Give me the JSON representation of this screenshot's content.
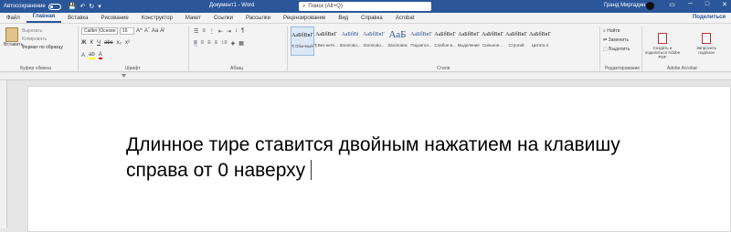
{
  "titlebar": {
    "autosave_label": "Автосохранение",
    "autosave_state": "off",
    "doc_title": "Документ1 - Word",
    "search_placeholder": "Поиск (Alt+Q)",
    "user_name": "Гранд Миргадин",
    "accent": "#2b579a"
  },
  "tabs": [
    "Файл",
    "Главная",
    "Вставка",
    "Рисование",
    "Конструктор",
    "Макет",
    "Ссылки",
    "Рассылки",
    "Рецензирование",
    "Вид",
    "Справка",
    "Acrobat"
  ],
  "active_tab": "Главная",
  "share_label": "Поделиться",
  "ribbon": {
    "clipboard": {
      "paste": "Вставить",
      "cut": "Вырезать",
      "copy": "Копировать",
      "format_painter": "Формат по образцу",
      "group": "Буфер обмена"
    },
    "font": {
      "name": "Calibri (Основн",
      "size": "16",
      "group": "Шрифт"
    },
    "paragraph": {
      "group": "Абзац"
    },
    "styles": {
      "group": "Стили",
      "items": [
        {
          "sample": "АаБбВвГ",
          "name": "¶ Обычный"
        },
        {
          "sample": "АаБбВвГ",
          "name": "¶ Без инте..."
        },
        {
          "sample": "АаБбВі",
          "name": "Заголово..."
        },
        {
          "sample": "АаБбВвГ",
          "name": "Заголово..."
        },
        {
          "sample": "АаБ",
          "name": "Заголовок"
        },
        {
          "sample": "АаБбВвГ",
          "name": "Подзагол..."
        },
        {
          "sample": "АаБбВеГ",
          "name": "Слабое в..."
        },
        {
          "sample": "АаБбВеГ",
          "name": "Выделение"
        },
        {
          "sample": "АаБбВвГ",
          "name": "Сильное..."
        },
        {
          "sample": "АаБбВвГ",
          "name": "Строгий"
        },
        {
          "sample": "АаБбВвГ",
          "name": "Цитата 2"
        }
      ]
    },
    "editing": {
      "find": "Найти",
      "replace": "Заменить",
      "select": "Выделить",
      "group": "Редактирование"
    },
    "adobe": {
      "create_share": "Создать и поделиться Adobe PDF",
      "request_sign": "Запросить подписи",
      "group": "Adobe Acrobat"
    }
  },
  "document": {
    "line1": "Длинное тире ставится двойным нажатием на клавишу",
    "line2": "справа от 0 наверху"
  }
}
